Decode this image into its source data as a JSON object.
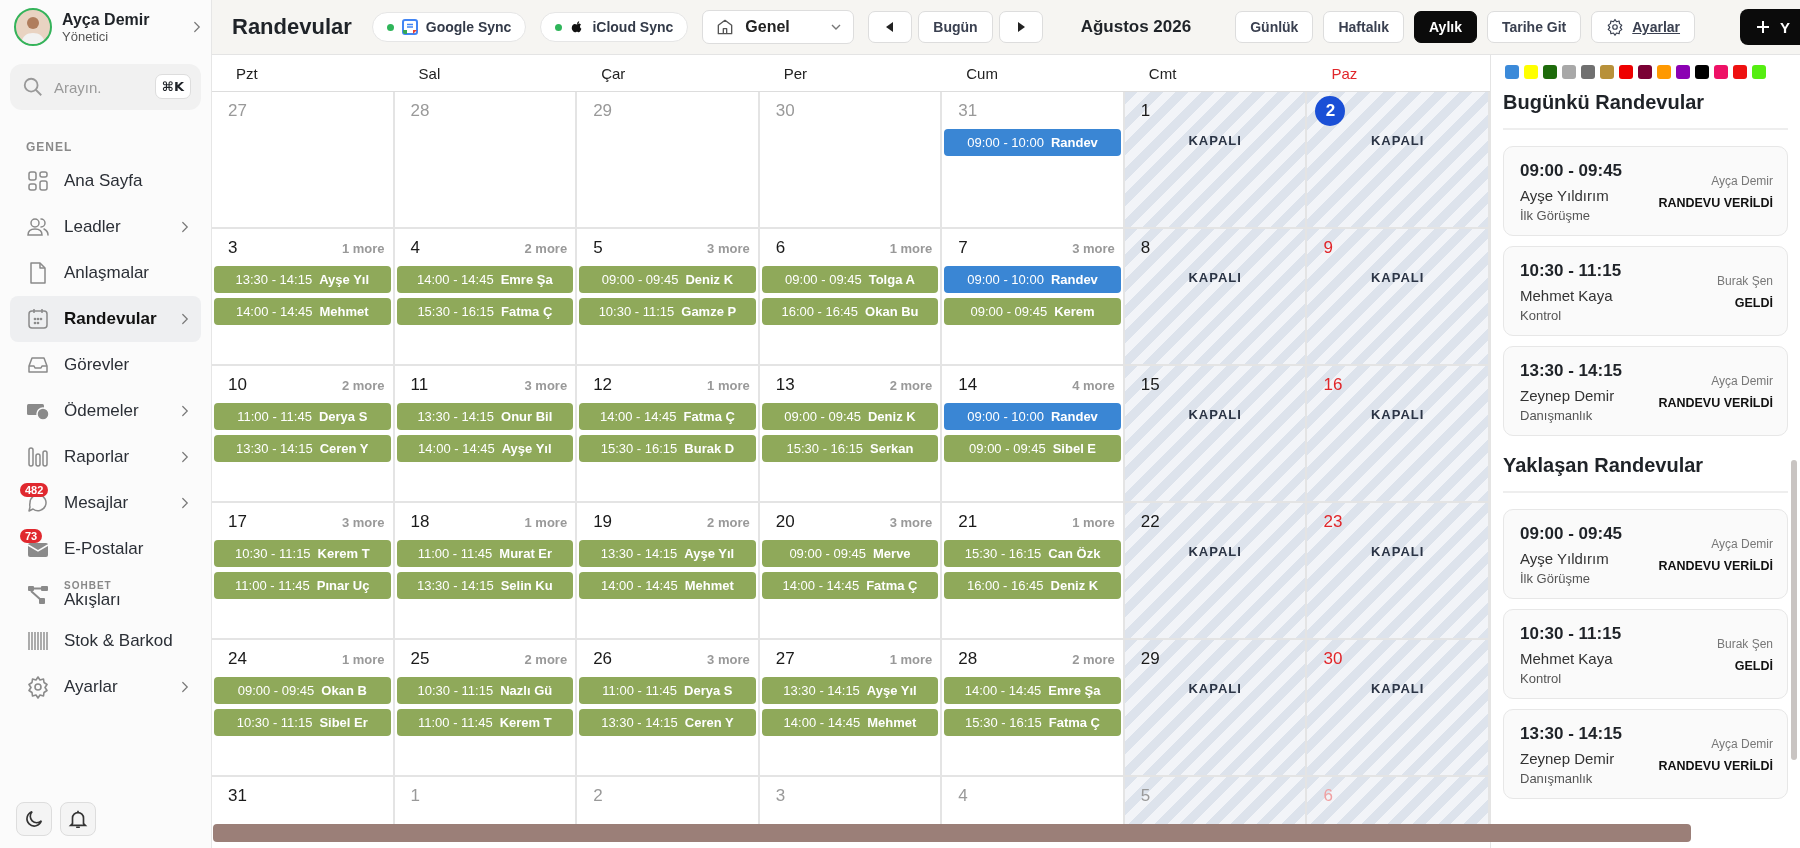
{
  "user": {
    "name": "Ayça Demir",
    "role": "Yönetici"
  },
  "search": {
    "placeholder": "Arayın.",
    "shortcut": "⌘K"
  },
  "sidebar": {
    "section": "GENEL",
    "items": [
      {
        "label": "Ana Sayfa",
        "kind": "grid",
        "chevron": false,
        "selected": false
      },
      {
        "label": "Leadler",
        "kind": "users",
        "chevron": true,
        "selected": false
      },
      {
        "label": "Anlaşmalar",
        "kind": "file",
        "chevron": false,
        "selected": false
      },
      {
        "label": "Randevular",
        "kind": "calendar",
        "chevron": true,
        "selected": true
      },
      {
        "label": "Görevler",
        "kind": "inbox",
        "chevron": false,
        "selected": false
      },
      {
        "label": "Ödemeler",
        "kind": "money",
        "chevron": true,
        "selected": false
      },
      {
        "label": "Raporlar",
        "kind": "bars",
        "chevron": true,
        "selected": false
      },
      {
        "label": "Mesajlar",
        "kind": "chat",
        "chevron": true,
        "selected": false,
        "badge": "482"
      },
      {
        "label": "E-Postalar",
        "kind": "mail",
        "chevron": false,
        "selected": false,
        "badge": "73"
      },
      {
        "label": "Akışları",
        "overline": "SOHBET",
        "kind": "flow",
        "chevron": false,
        "selected": false
      },
      {
        "label": "Stok & Barkod",
        "kind": "barcode",
        "chevron": false,
        "selected": false
      },
      {
        "label": "Ayarlar",
        "kind": "gear",
        "chevron": true,
        "selected": false
      }
    ]
  },
  "toolbar": {
    "title": "Randevular",
    "syncs": [
      {
        "label": "Google Sync",
        "kind": "google",
        "connected": true
      },
      {
        "label": "iCloud Sync",
        "kind": "apple",
        "connected": true
      }
    ],
    "calendar_select": "Genel",
    "today_button": "Bugün",
    "period": "Ağustos 2026",
    "views": [
      {
        "label": "Günlük",
        "selected": false
      },
      {
        "label": "Haftalık",
        "selected": false
      },
      {
        "label": "Aylık",
        "selected": true
      },
      {
        "label": "Tarihe Git",
        "selected": false
      }
    ],
    "settings_button": "Ayarlar",
    "add_button": "Y"
  },
  "calendar": {
    "weekdays": [
      {
        "label": "Pzt",
        "red": false
      },
      {
        "label": "Sal",
        "red": false
      },
      {
        "label": "Çar",
        "red": false
      },
      {
        "label": "Per",
        "red": false
      },
      {
        "label": "Cum",
        "red": false
      },
      {
        "label": "Cmt",
        "red": false
      },
      {
        "label": "Paz",
        "red": true
      }
    ],
    "weeks": [
      {
        "days": [
          {
            "date": "27",
            "outside": true
          },
          {
            "date": "28",
            "outside": true
          },
          {
            "date": "29",
            "outside": true
          },
          {
            "date": "30",
            "outside": true
          },
          {
            "date": "31",
            "outside": true,
            "events": [
              {
                "time": "09:00 - 10:00",
                "title": "Randev",
                "color": "#3a86d4"
              }
            ]
          },
          {
            "date": "1",
            "closed": true,
            "label": "KAPALI"
          },
          {
            "date": "2",
            "today": true,
            "closed": true,
            "label": "KAPALI"
          }
        ]
      },
      {
        "days": [
          {
            "date": "3",
            "more": "1 more",
            "events": [
              {
                "time": "13:30 - 14:15",
                "title": "Ayşe Yıl",
                "color": "#8fa95a"
              },
              {
                "time": "14:00 - 14:45",
                "title": "Mehmet",
                "color": "#8fa95a"
              }
            ]
          },
          {
            "date": "4",
            "more": "2 more",
            "events": [
              {
                "time": "14:00 - 14:45",
                "title": "Emre Şa",
                "color": "#8fa95a"
              },
              {
                "time": "15:30 - 16:15",
                "title": "Fatma Ç",
                "color": "#8fa95a"
              }
            ]
          },
          {
            "date": "5",
            "more": "3 more",
            "events": [
              {
                "time": "09:00 - 09:45",
                "title": "Deniz K",
                "color": "#8fa95a"
              },
              {
                "time": "10:30 - 11:15",
                "title": "Gamze P",
                "color": "#8fa95a"
              }
            ]
          },
          {
            "date": "6",
            "more": "1 more",
            "events": [
              {
                "time": "09:00 - 09:45",
                "title": "Tolga A",
                "color": "#8fa95a"
              },
              {
                "time": "16:00 - 16:45",
                "title": "Okan Bu",
                "color": "#8fa95a"
              }
            ]
          },
          {
            "date": "7",
            "more": "3 more",
            "events": [
              {
                "time": "09:00 - 10:00",
                "title": "Randev",
                "color": "#3a86d4"
              },
              {
                "time": "09:00 - 09:45",
                "title": "Kerem",
                "color": "#8fa95a"
              }
            ]
          },
          {
            "date": "8",
            "closed": true,
            "label": "KAPALI"
          },
          {
            "date": "9",
            "closed": true,
            "label": "KAPALI"
          }
        ]
      },
      {
        "days": [
          {
            "date": "10",
            "more": "2 more",
            "events": [
              {
                "time": "11:00 - 11:45",
                "title": "Derya S",
                "color": "#8fa95a"
              },
              {
                "time": "13:30 - 14:15",
                "title": "Ceren Y",
                "color": "#8fa95a"
              }
            ]
          },
          {
            "date": "11",
            "more": "3 more",
            "events": [
              {
                "time": "13:30 - 14:15",
                "title": "Onur Bil",
                "color": "#8fa95a"
              },
              {
                "time": "14:00 - 14:45",
                "title": "Ayşe Yıl",
                "color": "#8fa95a"
              }
            ]
          },
          {
            "date": "12",
            "more": "1 more",
            "events": [
              {
                "time": "14:00 - 14:45",
                "title": "Fatma Ç",
                "color": "#8fa95a"
              },
              {
                "time": "15:30 - 16:15",
                "title": "Burak D",
                "color": "#8fa95a"
              }
            ]
          },
          {
            "date": "13",
            "more": "2 more",
            "events": [
              {
                "time": "09:00 - 09:45",
                "title": "Deniz K",
                "color": "#8fa95a"
              },
              {
                "time": "15:30 - 16:15",
                "title": "Serkan",
                "color": "#8fa95a"
              }
            ]
          },
          {
            "date": "14",
            "more": "4 more",
            "events": [
              {
                "time": "09:00 - 10:00",
                "title": "Randev",
                "color": "#3a86d4"
              },
              {
                "time": "09:00 - 09:45",
                "title": "Sibel E",
                "color": "#8fa95a"
              }
            ]
          },
          {
            "date": "15",
            "closed": true,
            "label": "KAPALI"
          },
          {
            "date": "16",
            "closed": true,
            "label": "KAPALI"
          }
        ]
      },
      {
        "days": [
          {
            "date": "17",
            "more": "3 more",
            "events": [
              {
                "time": "10:30 - 11:15",
                "title": "Kerem T",
                "color": "#8fa95a"
              },
              {
                "time": "11:00 - 11:45",
                "title": "Pınar Uç",
                "color": "#8fa95a"
              }
            ]
          },
          {
            "date": "18",
            "more": "1 more",
            "events": [
              {
                "time": "11:00 - 11:45",
                "title": "Murat Er",
                "color": "#8fa95a"
              },
              {
                "time": "13:30 - 14:15",
                "title": "Selin Ku",
                "color": "#8fa95a"
              }
            ]
          },
          {
            "date": "19",
            "more": "2 more",
            "events": [
              {
                "time": "13:30 - 14:15",
                "title": "Ayşe Yıl",
                "color": "#8fa95a"
              },
              {
                "time": "14:00 - 14:45",
                "title": "Mehmet",
                "color": "#8fa95a"
              }
            ]
          },
          {
            "date": "20",
            "more": "3 more",
            "events": [
              {
                "time": "09:00 - 09:45",
                "title": "Merve",
                "color": "#8fa95a"
              },
              {
                "time": "14:00 - 14:45",
                "title": "Fatma Ç",
                "color": "#8fa95a"
              }
            ]
          },
          {
            "date": "21",
            "more": "1 more",
            "events": [
              {
                "time": "15:30 - 16:15",
                "title": "Can Özk",
                "color": "#8fa95a"
              },
              {
                "time": "16:00 - 16:45",
                "title": "Deniz K",
                "color": "#8fa95a"
              }
            ]
          },
          {
            "date": "22",
            "closed": true,
            "label": "KAPALI"
          },
          {
            "date": "23",
            "closed": true,
            "label": "KAPALI"
          }
        ]
      },
      {
        "days": [
          {
            "date": "24",
            "more": "1 more",
            "events": [
              {
                "time": "09:00 - 09:45",
                "title": "Okan B",
                "color": "#8fa95a"
              },
              {
                "time": "10:30 - 11:15",
                "title": "Sibel Er",
                "color": "#8fa95a"
              }
            ]
          },
          {
            "date": "25",
            "more": "2 more",
            "events": [
              {
                "time": "10:30 - 11:15",
                "title": "Nazlı Gü",
                "color": "#8fa95a"
              },
              {
                "time": "11:00 - 11:45",
                "title": "Kerem T",
                "color": "#8fa95a"
              }
            ]
          },
          {
            "date": "26",
            "more": "3 more",
            "events": [
              {
                "time": "11:00 - 11:45",
                "title": "Derya S",
                "color": "#8fa95a"
              },
              {
                "time": "13:30 - 14:15",
                "title": "Ceren Y",
                "color": "#8fa95a"
              }
            ]
          },
          {
            "date": "27",
            "more": "1 more",
            "events": [
              {
                "time": "13:30 - 14:15",
                "title": "Ayşe Yıl",
                "color": "#8fa95a"
              },
              {
                "time": "14:00 - 14:45",
                "title": "Mehmet",
                "color": "#8fa95a"
              }
            ]
          },
          {
            "date": "28",
            "more": "2 more",
            "events": [
              {
                "time": "14:00 - 14:45",
                "title": "Emre Şa",
                "color": "#8fa95a"
              },
              {
                "time": "15:30 - 16:15",
                "title": "Fatma Ç",
                "color": "#8fa95a"
              }
            ]
          },
          {
            "date": "29",
            "closed": true,
            "label": "KAPALI"
          },
          {
            "date": "30",
            "closed": true,
            "label": "KAPALI"
          }
        ]
      },
      {
        "days": [
          {
            "date": "31"
          },
          {
            "date": "1",
            "outside": true
          },
          {
            "date": "2",
            "outside": true
          },
          {
            "date": "3",
            "outside": true
          },
          {
            "date": "4",
            "outside": true
          },
          {
            "date": "5",
            "outside": true,
            "closed": true
          },
          {
            "date": "6",
            "outside": true,
            "closed": true
          }
        ]
      }
    ]
  },
  "palette": [
    {
      "color": "#3b8ad9"
    },
    {
      "color": "#ffff00"
    },
    {
      "color": "#1e6b0b"
    },
    {
      "color": "#a8a8a8"
    },
    {
      "color": "#707070"
    },
    {
      "color": "#b8913a"
    },
    {
      "color": "#ee0000"
    },
    {
      "color": "#7a0034"
    },
    {
      "color": "#ff9900"
    },
    {
      "color": "#8b00b3"
    },
    {
      "color": "#000000"
    },
    {
      "color": "#ee1166"
    },
    {
      "color": "#ee1111"
    },
    {
      "color": "#55ee11"
    }
  ],
  "panels": [
    {
      "title": "Bugünkü Randevular",
      "appointments": [
        {
          "time": "09:00 - 09:45",
          "name": "Ayşe Yıldırım",
          "type": "İlk Görüşme",
          "staff": "Ayça Demir",
          "status": "RANDEVU VERİLDİ"
        },
        {
          "time": "10:30 - 11:15",
          "name": "Mehmet Kaya",
          "type": "Kontrol",
          "staff": "Burak Şen",
          "status": "GELDİ"
        },
        {
          "time": "13:30 - 14:15",
          "name": "Zeynep Demir",
          "type": "Danışmanlık",
          "staff": "Ayça Demir",
          "status": "RANDEVU VERİLDİ"
        }
      ]
    },
    {
      "title": "Yaklaşan Randevular",
      "appointments": [
        {
          "time": "09:00 - 09:45",
          "name": "Ayşe Yıldırım",
          "type": "İlk Görüşme",
          "staff": "Ayça Demir",
          "status": "RANDEVU VERİLDİ"
        },
        {
          "time": "10:30 - 11:15",
          "name": "Mehmet Kaya",
          "type": "Kontrol",
          "staff": "Burak Şen",
          "status": "GELDİ"
        },
        {
          "time": "13:30 - 14:15",
          "name": "Zeynep Demir",
          "type": "Danışmanlık",
          "staff": "Ayça Demir",
          "status": "RANDEVU VERİLDİ"
        }
      ]
    }
  ]
}
